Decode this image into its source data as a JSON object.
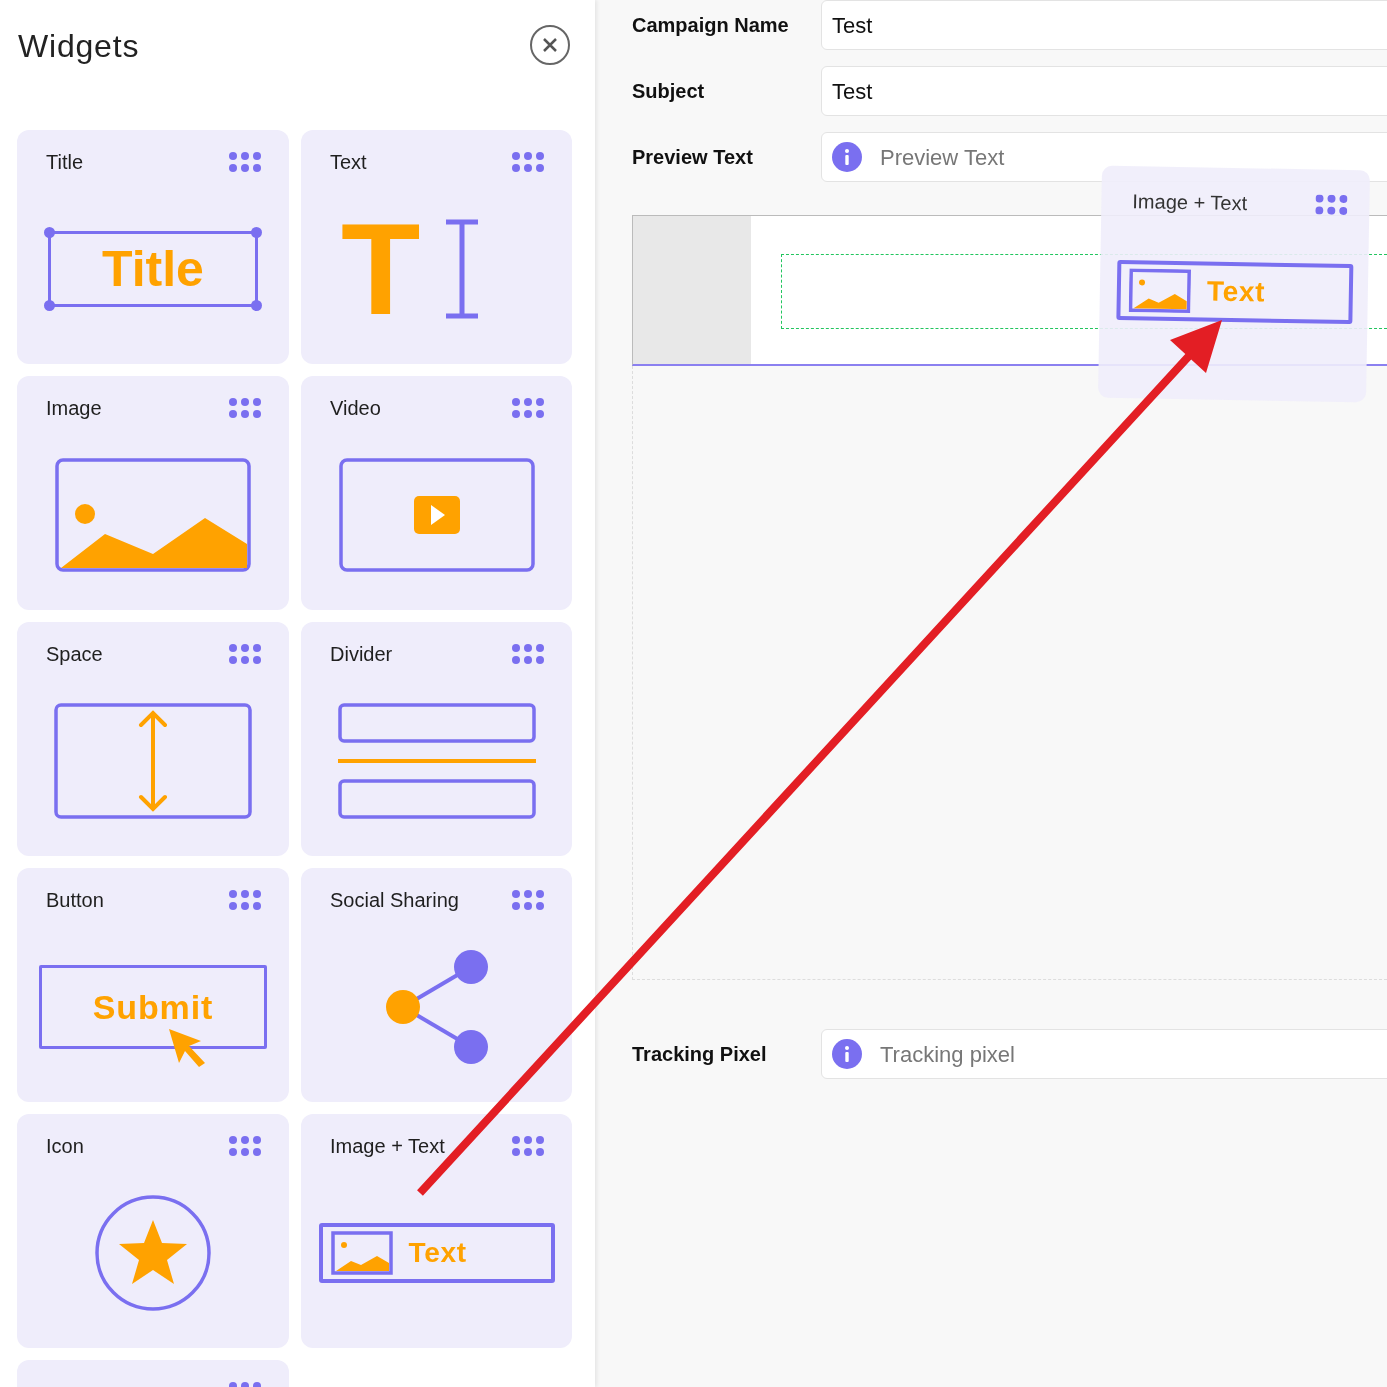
{
  "panel": {
    "title": "Widgets"
  },
  "widgets": [
    {
      "kind": "title",
      "label": "Title",
      "art_text": "Title"
    },
    {
      "kind": "text",
      "label": "Text",
      "art_text": "T"
    },
    {
      "kind": "image",
      "label": "Image"
    },
    {
      "kind": "video",
      "label": "Video"
    },
    {
      "kind": "space",
      "label": "Space"
    },
    {
      "kind": "divider",
      "label": "Divider"
    },
    {
      "kind": "button",
      "label": "Button",
      "art_text": "Submit"
    },
    {
      "kind": "social",
      "label": "Social Sharing"
    },
    {
      "kind": "icon",
      "label": "Icon"
    },
    {
      "kind": "image_text",
      "label": "Image + Text",
      "art_text": "Text"
    },
    {
      "kind": "cut"
    }
  ],
  "form": [
    {
      "label": "Campaign Name",
      "value": "Test"
    },
    {
      "label": "Subject",
      "value": "Test"
    },
    {
      "label": "Preview Text",
      "placeholder": "Preview Text",
      "info": true
    }
  ],
  "tracking": {
    "label": "Tracking Pixel",
    "placeholder": "Tracking pixel",
    "info": true
  },
  "drag_preview": {
    "label": "Image + Text",
    "art_text": "Text"
  }
}
